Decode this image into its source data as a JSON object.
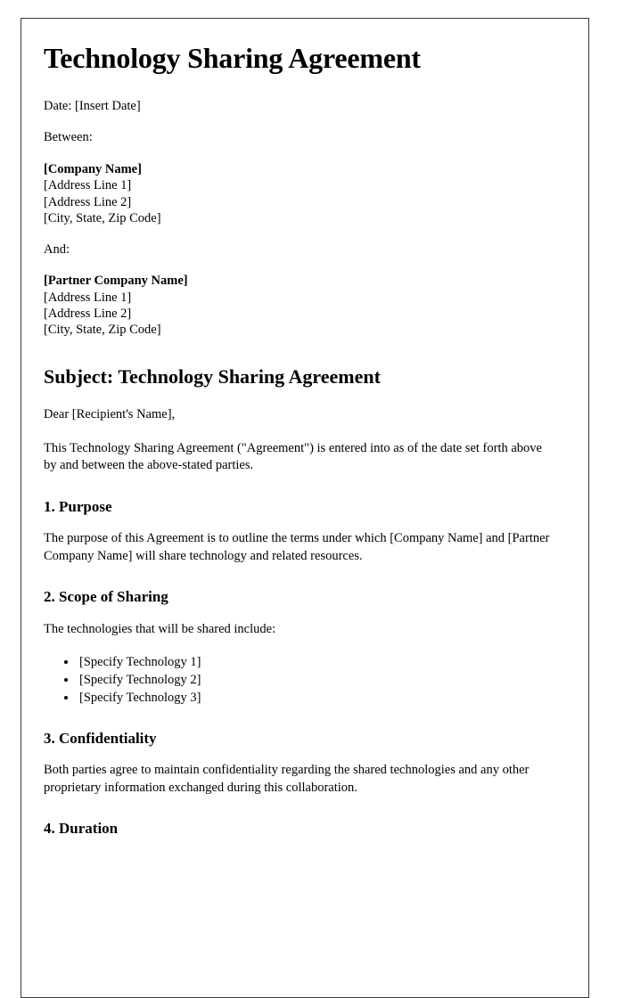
{
  "document": {
    "title": "Technology Sharing Agreement",
    "date_line": "Date: [Insert Date]",
    "between_label": "Between:",
    "and_label": "And:",
    "party_a": {
      "name": "[Company Name]",
      "address_line_1": "[Address Line 1]",
      "address_line_2": "[Address Line 2]",
      "city_state_zip": "[City, State, Zip Code]"
    },
    "party_b": {
      "name": "[Partner Company Name]",
      "address_line_1": "[Address Line 1]",
      "address_line_2": "[Address Line 2]",
      "city_state_zip": "[City, State, Zip Code]"
    },
    "subject_heading": "Subject: Technology Sharing Agreement",
    "salutation": "Dear [Recipient's Name],",
    "intro_paragraph": "This Technology Sharing Agreement (\"Agreement\") is entered into as of the date set forth above by and between the above-stated parties.",
    "sections": [
      {
        "heading": "1. Purpose",
        "paragraph": "The purpose of this Agreement is to outline the terms under which [Company Name] and [Partner Company Name] will share technology and related resources."
      },
      {
        "heading": "2. Scope of Sharing",
        "paragraph": "The technologies that will be shared include:",
        "items": [
          "[Specify Technology 1]",
          "[Specify Technology 2]",
          "[Specify Technology 3]"
        ]
      },
      {
        "heading": "3. Confidentiality",
        "paragraph": "Both parties agree to maintain confidentiality regarding the shared technologies and any other proprietary information exchanged during this collaboration."
      },
      {
        "heading": "4. Duration",
        "paragraph": ""
      }
    ],
    "colors": {
      "text": "#000000",
      "page_background": "#ffffff",
      "page_border": "#3a3a3a"
    }
  }
}
